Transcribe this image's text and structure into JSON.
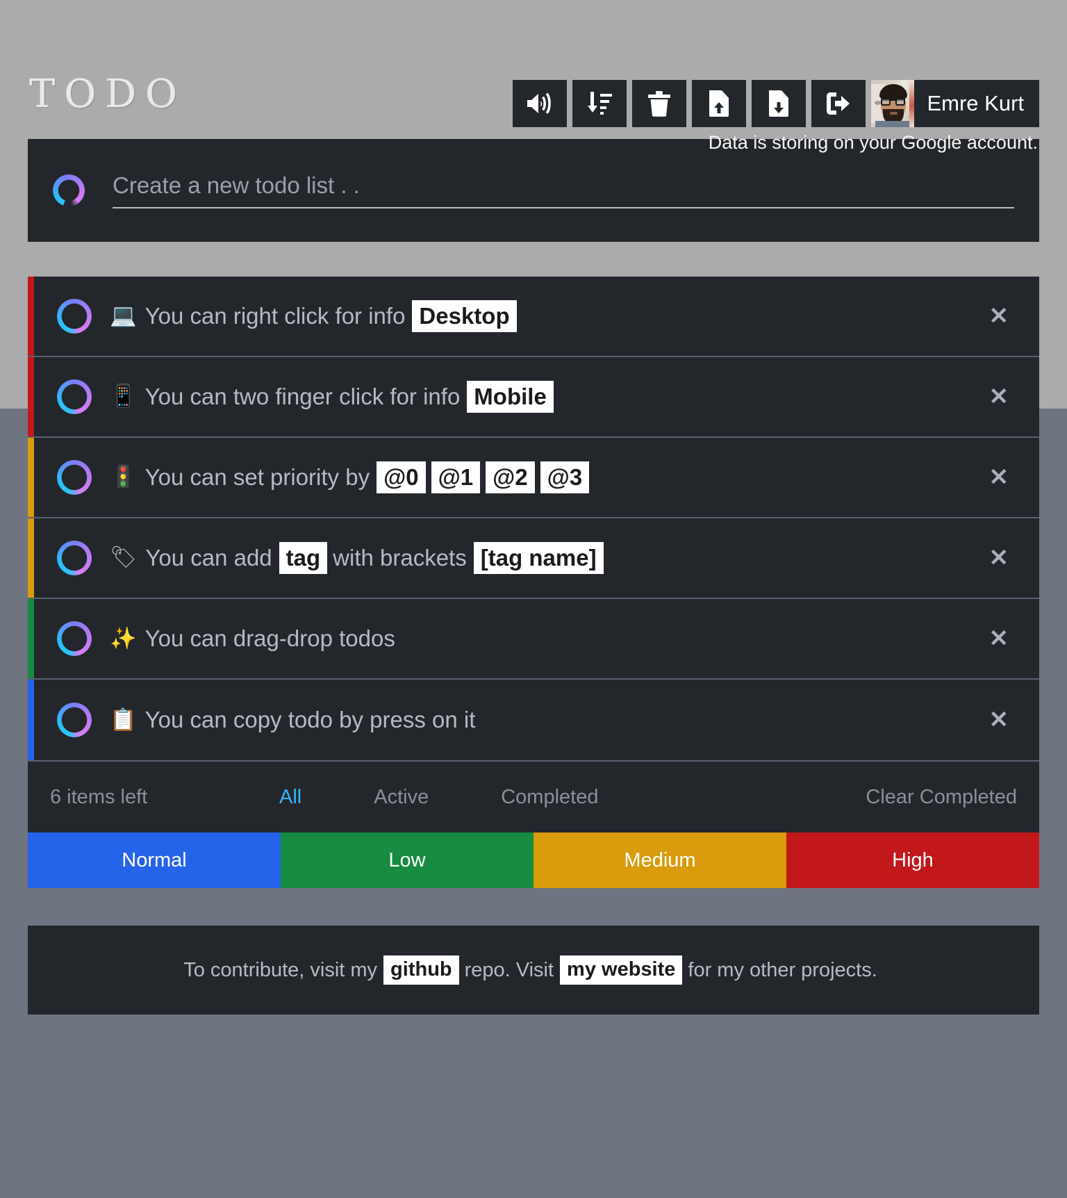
{
  "app": {
    "logo_text": "TODO",
    "background_top_color": "#ababab",
    "background_bottom_color": "#6e7580",
    "card_color": "#23272c"
  },
  "header": {
    "toolbar": [
      {
        "name": "sound-toggle",
        "icon": "volume-up-icon",
        "label": "Sound"
      },
      {
        "name": "sort-todos",
        "icon": "sort-amount-down-icon",
        "label": "Sort"
      },
      {
        "name": "delete-all",
        "icon": "trash-icon",
        "label": "Delete all"
      },
      {
        "name": "import-file",
        "icon": "file-upload-icon",
        "label": "Import"
      },
      {
        "name": "export-file",
        "icon": "file-download-icon",
        "label": "Export"
      },
      {
        "name": "sign-out",
        "icon": "sign-out-icon",
        "label": "Sign out"
      }
    ],
    "user_name": "Emre Kurt",
    "storing_note": "Data is storing on your Google account."
  },
  "new_todo": {
    "placeholder": "Create a new todo list . .",
    "value": "",
    "ring_gradient_from": "#29c6f6",
    "ring_gradient_to": "#d77ef4"
  },
  "todos": [
    {
      "priority_color": "#c2181b",
      "priority": "High",
      "emoji": "💻",
      "emoji_name": "laptop-emoji",
      "segments": [
        {
          "type": "text",
          "value": "You can right click for info"
        },
        {
          "type": "code",
          "value": "Desktop"
        }
      ],
      "delete_label": "✕",
      "completed": false
    },
    {
      "priority_color": "#c2181b",
      "priority": "High",
      "emoji": "📱",
      "emoji_name": "mobile-phone-emoji",
      "segments": [
        {
          "type": "text",
          "value": "You can two finger click for info"
        },
        {
          "type": "code",
          "value": "Mobile"
        }
      ],
      "delete_label": "✕",
      "completed": false
    },
    {
      "priority_color": "#d79b0c",
      "priority": "Medium",
      "emoji": "🚦",
      "emoji_name": "traffic-light-emoji",
      "segments": [
        {
          "type": "text",
          "value": "You can set priority by"
        },
        {
          "type": "code",
          "value": "@0"
        },
        {
          "type": "code",
          "value": "@1"
        },
        {
          "type": "code",
          "value": "@2"
        },
        {
          "type": "code",
          "value": "@3"
        }
      ],
      "delete_label": "✕",
      "completed": false
    },
    {
      "priority_color": "#d79b0c",
      "priority": "Medium",
      "emoji": "🏷",
      "emoji_name": "label-tag-emoji",
      "segments": [
        {
          "type": "text",
          "value": "You can add"
        },
        {
          "type": "code",
          "value": "tag"
        },
        {
          "type": "text",
          "value": "with brackets"
        },
        {
          "type": "code",
          "value": "[tag name]"
        }
      ],
      "delete_label": "✕",
      "completed": false
    },
    {
      "priority_color": "#168b41",
      "priority": "Low",
      "emoji": "✨",
      "emoji_name": "sparkles-emoji",
      "segments": [
        {
          "type": "text",
          "value": "You can drag-drop todos"
        }
      ],
      "delete_label": "✕",
      "completed": false
    },
    {
      "priority_color": "#2563e8",
      "priority": "Normal",
      "emoji": "📋",
      "emoji_name": "clipboard-emoji",
      "segments": [
        {
          "type": "text",
          "value": "You can copy todo by press on it"
        }
      ],
      "delete_label": "✕",
      "completed": false
    }
  ],
  "list_footer": {
    "items_left": "6 items left",
    "filters": [
      {
        "label": "All",
        "active": true
      },
      {
        "label": "Active",
        "active": false
      },
      {
        "label": "Completed",
        "active": false
      }
    ],
    "clear_completed": "Clear Completed",
    "active_filter_color": "#31b7f7"
  },
  "legend": [
    {
      "label": "Normal",
      "color": "#2563e8"
    },
    {
      "label": "Low",
      "color": "#168b41"
    },
    {
      "label": "Medium",
      "color": "#d79b0c"
    },
    {
      "label": "High",
      "color": "#c2181b"
    }
  ],
  "page_footer": {
    "segments": [
      {
        "type": "text",
        "value": "To contribute, visit my"
      },
      {
        "type": "code",
        "value": "github"
      },
      {
        "type": "text",
        "value": "repo. Visit"
      },
      {
        "type": "code",
        "value": "my website"
      },
      {
        "type": "text",
        "value": "for my other projects."
      }
    ]
  }
}
